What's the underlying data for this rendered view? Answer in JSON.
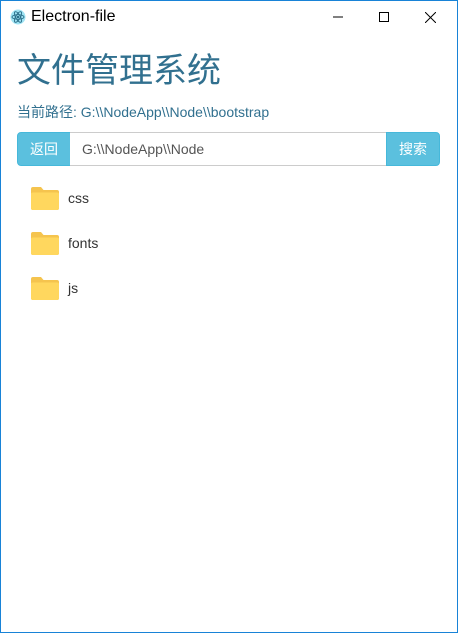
{
  "window": {
    "title": "Electron-file",
    "controls": [
      "minimize-icon",
      "maximize-icon",
      "close-icon"
    ]
  },
  "header": {
    "title": "文件管理系统"
  },
  "path": {
    "label": "当前路径:",
    "value": "G:\\\\NodeApp\\\\Node\\\\bootstrap"
  },
  "search": {
    "back_label": "返回",
    "input_value": "G:\\\\NodeApp\\\\Node",
    "search_label": "搜索"
  },
  "files": [
    {
      "name": "css",
      "icon": "folder-icon"
    },
    {
      "name": "fonts",
      "icon": "folder-icon"
    },
    {
      "name": "js",
      "icon": "folder-icon"
    }
  ],
  "colors": {
    "accent": "#5bc0de",
    "title_text": "#31708f",
    "folder": "#ffd75e",
    "window_border": "#1883d7"
  }
}
